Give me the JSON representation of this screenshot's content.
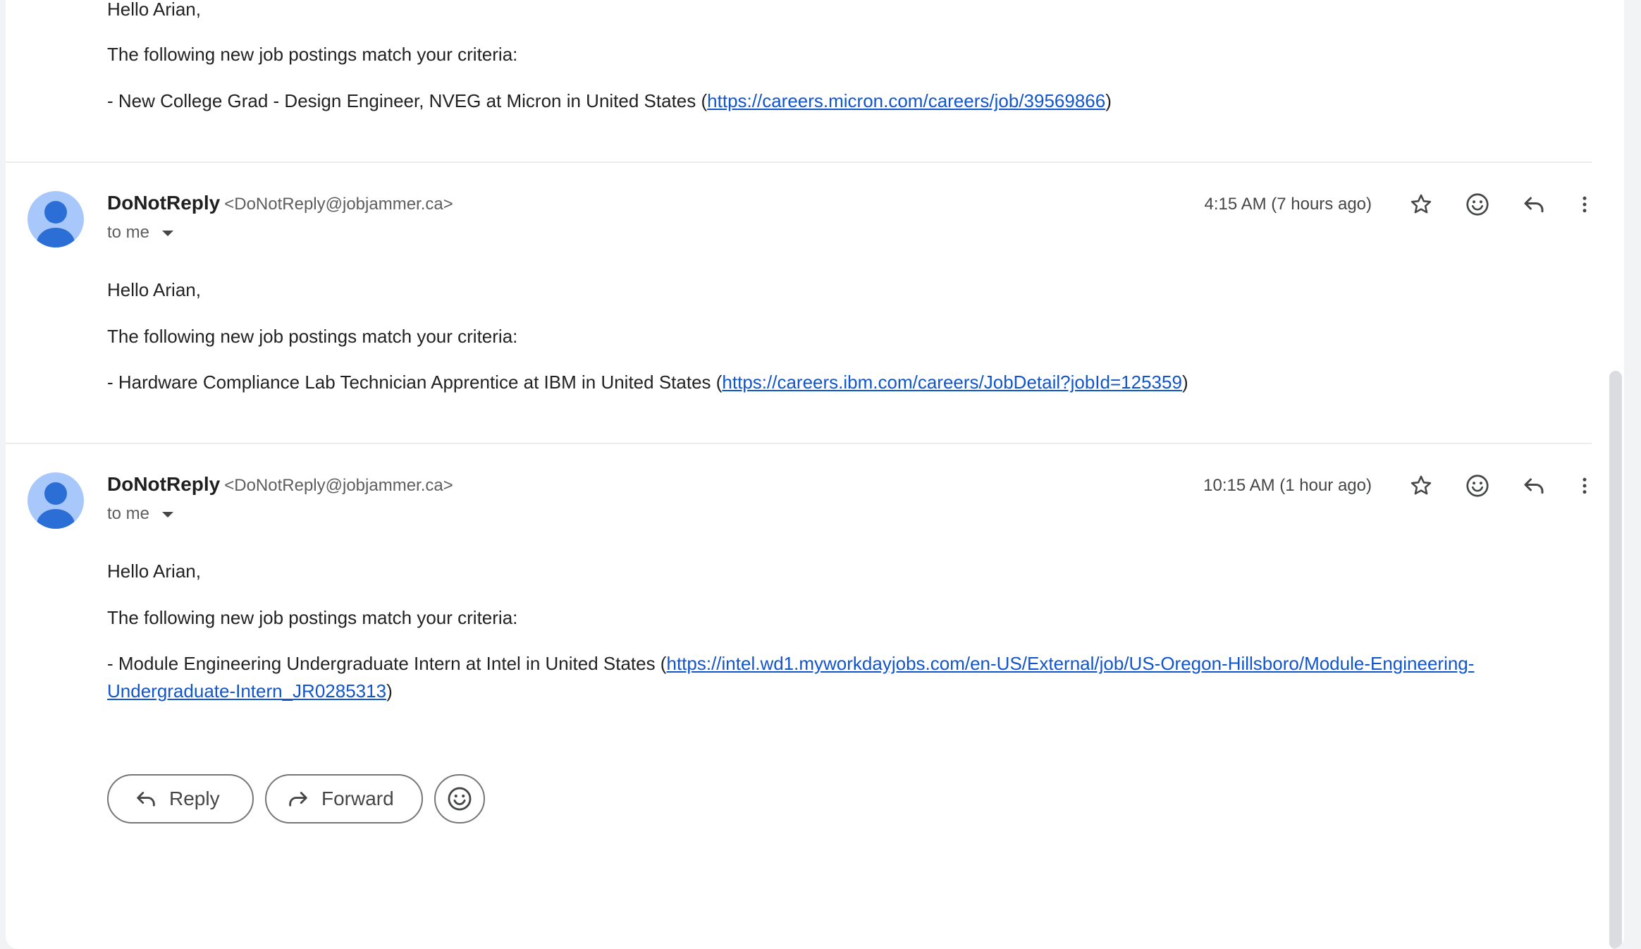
{
  "messages": [
    {
      "greeting": "Hello Arian,",
      "intro": "The following new job postings match your criteria:",
      "posting_text": "- New College Grad - Design Engineer, NVEG at Micron in United States (",
      "posting_link": "https://careers.micron.com/careers/job/39569866",
      "posting_close": ")"
    },
    {
      "sender_name": "DoNotReply",
      "sender_email": "<DoNotReply@jobjammer.ca>",
      "to": "to me",
      "time": "4:15 AM (7 hours ago)",
      "greeting": "Hello Arian,",
      "intro": "The following new job postings match your criteria:",
      "posting_text": "- Hardware Compliance Lab Technician Apprentice at IBM in United States (",
      "posting_link": "https://careers.ibm.com/careers/JobDetail?jobId=125359",
      "posting_close": ")"
    },
    {
      "sender_name": "DoNotReply",
      "sender_email": "<DoNotReply@jobjammer.ca>",
      "to": "to me",
      "time": "10:15 AM (1 hour ago)",
      "greeting": "Hello Arian,",
      "intro": "The following new job postings match your criteria:",
      "posting_text": "- Module Engineering Undergraduate Intern at Intel in United States (",
      "posting_link_line1": "https://intel.wd1.myworkdayjobs.com/en-US/External/job/US-Oregon-Hillsboro/Module-Engineering-",
      "posting_link_line2": "Undergraduate-Intern_JR0285313",
      "posting_close": ")"
    }
  ],
  "actions": {
    "reply_label": "Reply",
    "forward_label": "Forward"
  },
  "icons": {
    "star": "star-icon",
    "emoji": "emoji-icon",
    "reply": "reply-icon",
    "more": "more-vert-icon",
    "forward": "forward-icon"
  },
  "colors": {
    "link": "#1155cc",
    "avatar_bg": "#a8c7fa",
    "avatar_fg": "#2b6fd6"
  }
}
